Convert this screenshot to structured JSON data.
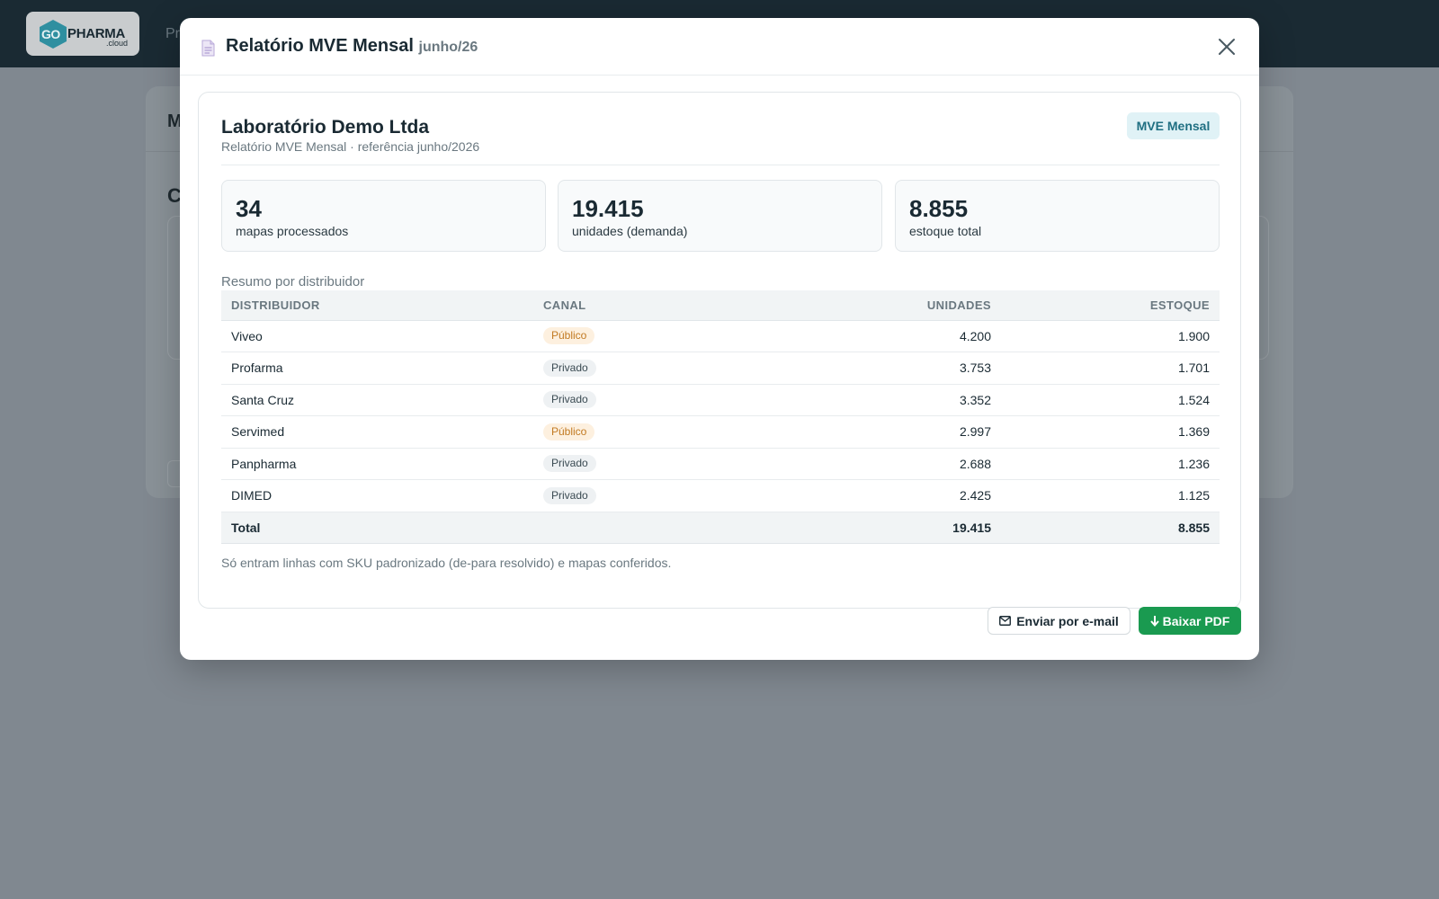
{
  "app": {
    "logo_go": "GO",
    "logo_pharma": "PHARMA",
    "logo_cloud": ".cloud",
    "nav_fragment": "Pr",
    "bg_title_fragment": "M",
    "bg_section_fragment": "C"
  },
  "modal": {
    "title": "Relatório MVE Mensal",
    "period": "junho/26",
    "icons": {
      "title": "document-icon",
      "close": "close-icon"
    }
  },
  "report": {
    "company": "Laboratório Demo Ltda",
    "subtitle": "Relatório MVE Mensal · referência junho/2026",
    "tag": "MVE Mensal",
    "stats": [
      {
        "value": "34",
        "label": "mapas processados"
      },
      {
        "value": "19.415",
        "label": "unidades (demanda)"
      },
      {
        "value": "8.855",
        "label": "estoque total"
      }
    ],
    "section_title": "Resumo por distribuidor",
    "columns": [
      "DISTRIBUIDOR",
      "CANAL",
      "UNIDADES",
      "ESTOQUE"
    ],
    "rows": [
      {
        "distribuidor": "Viveo",
        "canal": "Público",
        "unidades": "4.200",
        "estoque": "1.900"
      },
      {
        "distribuidor": "Profarma",
        "canal": "Privado",
        "unidades": "3.753",
        "estoque": "1.701"
      },
      {
        "distribuidor": "Santa Cruz",
        "canal": "Privado",
        "unidades": "3.352",
        "estoque": "1.524"
      },
      {
        "distribuidor": "Servimed",
        "canal": "Público",
        "unidades": "2.997",
        "estoque": "1.369"
      },
      {
        "distribuidor": "Panpharma",
        "canal": "Privado",
        "unidades": "2.688",
        "estoque": "1.236"
      },
      {
        "distribuidor": "DIMED",
        "canal": "Privado",
        "unidades": "2.425",
        "estoque": "1.125"
      }
    ],
    "total": {
      "label": "Total",
      "unidades": "19.415",
      "estoque": "8.855"
    },
    "footnote": "Só entram linhas com SKU padronizado (de-para resolvido) e mapas conferidos."
  },
  "actions": {
    "email_label": "Enviar por e-mail",
    "email_icon": "mail-icon",
    "pdf_label": "Baixar PDF",
    "pdf_icon": "download-arrow-icon"
  },
  "colors": {
    "accent_green": "#1a9a50",
    "tag_bg": "#e0f2f6",
    "tag_text": "#1f6f82",
    "publico_bg": "#fdf0df",
    "publico_text": "#c27a22",
    "privado_bg": "#eef1f3"
  }
}
